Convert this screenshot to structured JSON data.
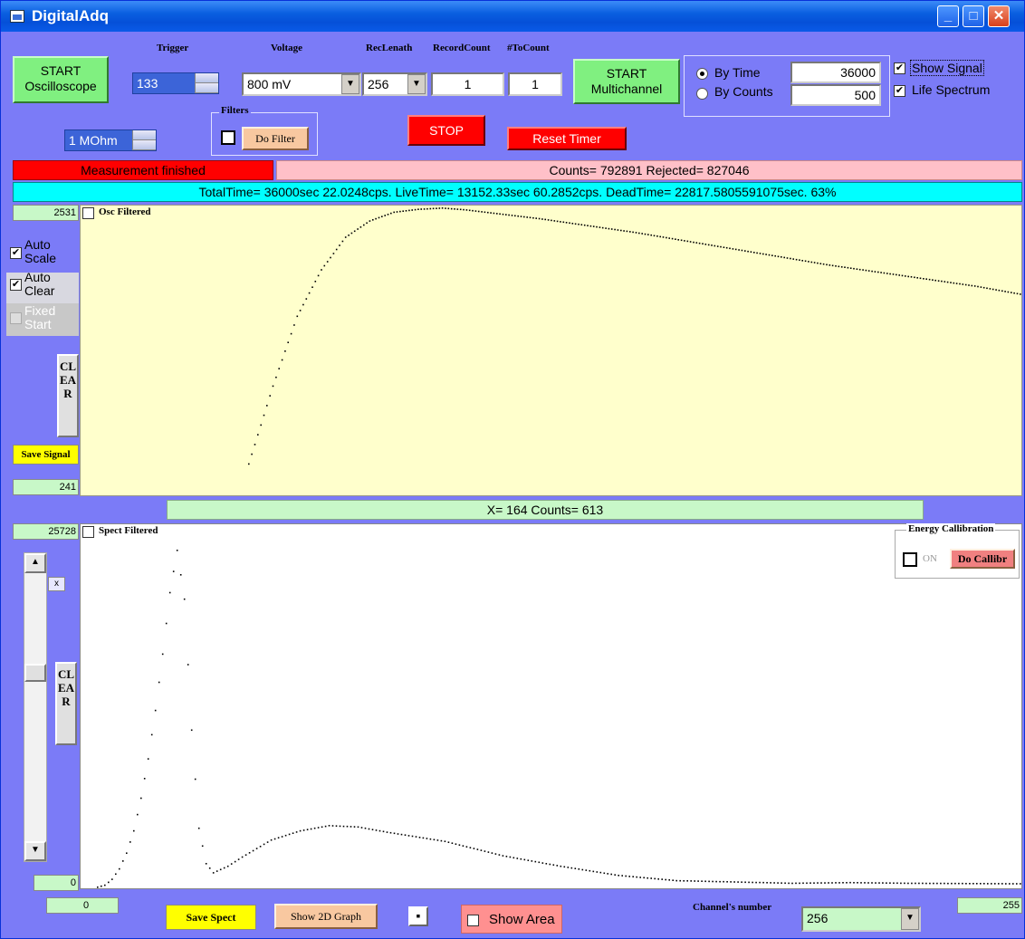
{
  "window": {
    "title": "DigitalAdq"
  },
  "controls": {
    "start_osc": "START\nOscilloscope",
    "trigger_label": "Trigger",
    "trigger_value": "133",
    "voltage_label": "Voltage",
    "voltage_value": "800 mV",
    "reclength_label": "RecLenath",
    "reclength_value": "256",
    "recordcount_label": "RecordCount",
    "recordcount_value": "1",
    "tocount_label": "#ToCount",
    "tocount_value": "1",
    "start_multi": "START\nMultichannel",
    "by_time_label": "By Time",
    "by_time_value": "36000",
    "by_counts_label": "By Counts",
    "by_counts_value": "500",
    "show_signal": "Show Signal",
    "life_spectrum": "Life Spectrum",
    "impedance": "1 MOhm",
    "filters_label": "Filters",
    "do_filter": "Do Filter",
    "stop": "STOP",
    "reset_timer": "Reset Timer"
  },
  "status": {
    "measurement": "Measurement finished",
    "counts": "Counts= 792891 Rejected= 827046",
    "times": "TotalTime= 36000sec  22.0248cps.      LiveTime= 13152.33sec  60.2852cps.      DeadTime= 22817.5805591075sec.  63%"
  },
  "osc": {
    "ymax": "2531",
    "ymin": "241",
    "filtered_label": "Osc Filtered",
    "auto_scale": "Auto Scale",
    "auto_clear": "Auto Clear",
    "fixed_start": "Fixed Start",
    "clear": "CLEAR",
    "save_signal": "Save Signal"
  },
  "cursor": {
    "readout": "X= 164 Counts= 613"
  },
  "spect": {
    "ymax": "25728",
    "ymin": "0",
    "xmin": "0",
    "xmax": "255",
    "filtered_label": "Spect Filtered",
    "scale_x": "x",
    "clear": "CLEAR",
    "energy_label": "Energy Callibration",
    "on_label": "ON",
    "do_calib": "Do Callibr",
    "save_spect": "Save Spect",
    "show_2d": "Show 2D Graph",
    "show_area": "Show Area",
    "channels_label": "Channel's number",
    "channels_value": "256"
  },
  "chart_data": [
    {
      "type": "scatter",
      "name": "oscilloscope",
      "x": [
        0,
        8,
        16,
        24,
        32,
        40,
        48,
        56,
        64,
        72,
        80,
        96,
        112,
        128,
        144,
        160,
        176,
        192,
        208,
        224,
        240,
        255
      ],
      "y": [
        330,
        1000,
        1600,
        2000,
        2280,
        2420,
        2495,
        2520,
        2531,
        2515,
        2490,
        2440,
        2380,
        2320,
        2250,
        2180,
        2110,
        2040,
        1980,
        1920,
        1860,
        1790
      ],
      "ylim": [
        241,
        2531
      ]
    },
    {
      "type": "scatter",
      "name": "spectrum",
      "x": [
        0,
        2,
        4,
        6,
        8,
        10,
        12,
        14,
        16,
        18,
        20,
        22,
        24,
        26,
        28,
        30,
        32,
        36,
        40,
        48,
        56,
        64,
        72,
        80,
        96,
        112,
        128,
        144,
        160,
        176,
        192,
        208,
        224,
        240,
        255
      ],
      "y": [
        0,
        150,
        600,
        1400,
        2600,
        4300,
        6800,
        9800,
        13500,
        17800,
        22500,
        25728,
        22000,
        12000,
        4500,
        1800,
        1100,
        1600,
        2300,
        3600,
        4300,
        4700,
        4600,
        4200,
        3500,
        2400,
        1600,
        900,
        500,
        400,
        300,
        350,
        300,
        280,
        260
      ],
      "ylim": [
        0,
        25728
      ]
    }
  ]
}
